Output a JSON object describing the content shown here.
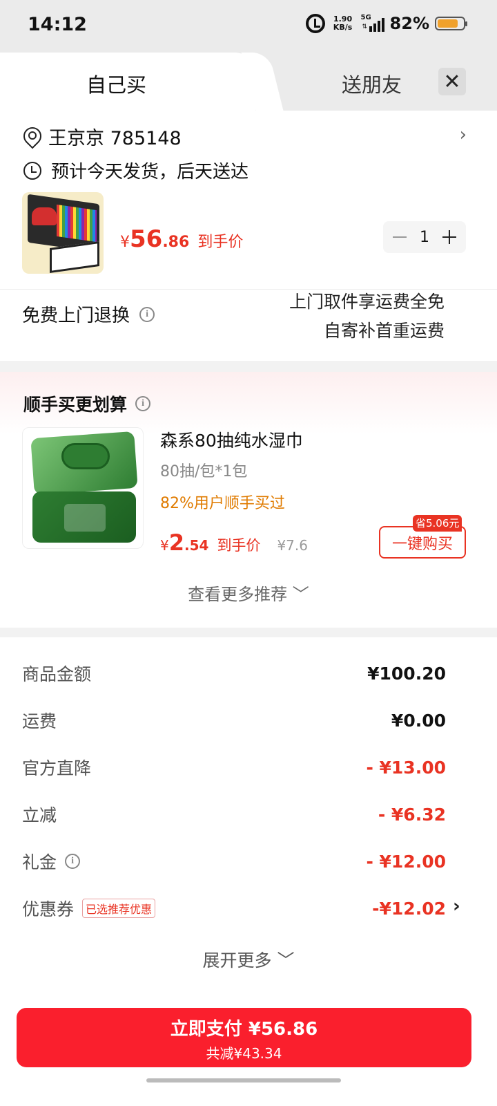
{
  "status_bar": {
    "time": "14:12",
    "net_speed_value": "1.90",
    "net_speed_unit": "KB/s",
    "network": "5G",
    "battery_percent": "82%",
    "battery_level": 0.82
  },
  "tabs": {
    "self_buy": "自己买",
    "send_friend": "送朋友",
    "close": "✕"
  },
  "address": {
    "name_phone": "王京京  785148",
    "eta": "预计今天发货，后天送达"
  },
  "product": {
    "price_currency": "¥",
    "price_int": "56",
    "price_dec": ".86",
    "price_tag": "到手价",
    "quantity": "1"
  },
  "returns": {
    "label": "免费上门退换",
    "line1": "上门取件享运费全免",
    "line2": "自寄补首重运费"
  },
  "recommend": {
    "title": "顺手买更划算",
    "name": "森系80抽纯水湿巾",
    "spec": "80抽/包*1包",
    "stat": "82%用户顺手买过",
    "price_currency": "¥",
    "price_int": "2",
    "price_dec": ".54",
    "price_tag": "到手价",
    "orig_price": "¥7.6",
    "save_badge": "省5.06元",
    "buy_button": "一键购买",
    "more": "查看更多推荐 ﹀"
  },
  "fees": [
    {
      "label": "商品金额",
      "value": "¥100.20"
    },
    {
      "label": "运费",
      "value": "¥0.00"
    },
    {
      "label": "官方直降",
      "value": "- ¥13.00"
    },
    {
      "label": "立减",
      "value": "- ¥6.32"
    },
    {
      "label": "礼金",
      "value": "- ¥12.00"
    },
    {
      "label": "优惠券",
      "value": "-¥12.02",
      "tag": "已选推荐优惠"
    }
  ],
  "expand_more": "展开更多 ﹀",
  "pay": {
    "label": "立即支付 ¥56.86",
    "saved": "共减¥43.34"
  },
  "colors": {
    "accent_red": "#e93323",
    "pay_red": "#fa1f2d",
    "stat_orange": "#e07b00"
  }
}
